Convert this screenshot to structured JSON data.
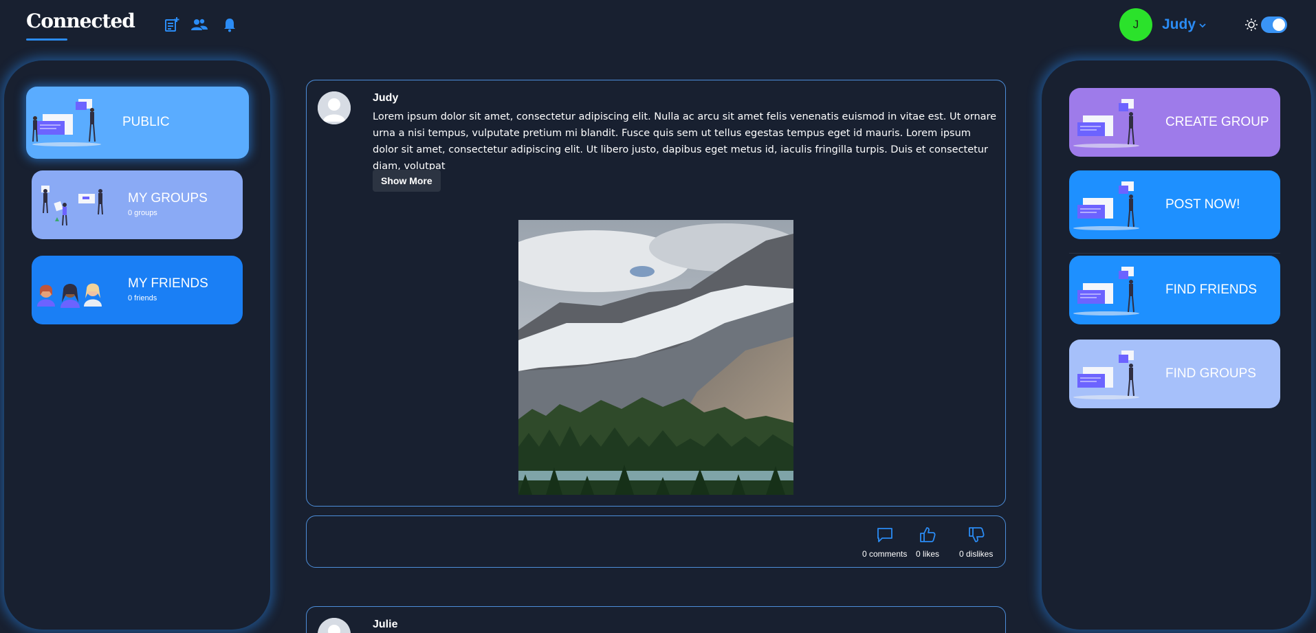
{
  "header": {
    "logo": "Connected",
    "icons": [
      "new-post-icon",
      "add-friend-icon",
      "notifications-icon"
    ],
    "user": {
      "initial": "J",
      "name": "Judy"
    },
    "theme_toggle": {
      "icon": "sun-icon",
      "on": true
    }
  },
  "left_nav": [
    {
      "label": "PUBLIC",
      "sub": ""
    },
    {
      "label": "MY GROUPS",
      "sub": "0 groups"
    },
    {
      "label": "MY FRIENDS",
      "sub": "0 friends"
    }
  ],
  "right_nav": [
    {
      "label": "CREATE GROUP"
    },
    {
      "label": "POST NOW!"
    },
    {
      "label": "FIND FRIENDS"
    },
    {
      "label": "FIND GROUPS"
    }
  ],
  "posts": [
    {
      "author": "Judy",
      "body": "Lorem ipsum dolor sit amet, consectetur adipiscing elit. Nulla ac arcu sit amet felis venenatis euismod in vitae est. Ut ornare urna a nisi tempus, vulputate pretium mi blandit. Fusce quis sem ut tellus egestas tempus eget id mauris. Lorem ipsum dolor sit amet, consectetur adipiscing elit. Ut libero justo, dapibus eget metus id, iaculis fringilla turpis. Duis et consectetur diam, volutpat",
      "show_more": "Show More",
      "comments": "0 comments",
      "likes": "0 likes",
      "dislikes": "0 dislikes"
    },
    {
      "author": "Julie"
    }
  ],
  "colors": {
    "background": "#182030",
    "accent": "#2b8cf5",
    "public_card": "#5aacff",
    "groups_card": "#8aaaf5",
    "friends_card": "#1a7ff5",
    "create_group_card": "#9e7bea",
    "post_now_card": "#1e90ff",
    "find_groups_card": "#a6c0fa",
    "avatar_green": "#2be22b"
  }
}
